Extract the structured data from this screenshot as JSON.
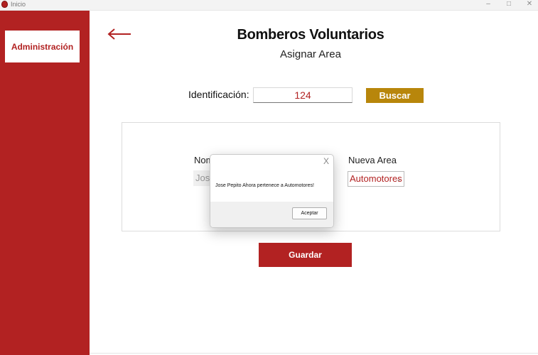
{
  "window": {
    "title": "Inicio",
    "minimize_icon": "minimize-icon",
    "maximize_icon": "maximize-icon",
    "close_icon": "close-icon"
  },
  "sidebar": {
    "admin_label": "Administración"
  },
  "header": {
    "title": "Bomberos Voluntarios",
    "subtitle": "Asignar Area",
    "back_icon": "arrow-left-icon"
  },
  "search": {
    "label": "Identificación:",
    "value": "124",
    "button_label": "Buscar"
  },
  "form": {
    "name_label": "Nom",
    "name_value": "Jose",
    "area_label": "Nueva Area",
    "area_value": "Automotores"
  },
  "actions": {
    "save_label": "Guardar"
  },
  "dialog": {
    "message": "Jose Pepito Ahora pertenece a Automotores!",
    "ok_label": "Aceptar",
    "close_glyph": "X"
  },
  "colors": {
    "brand_red": "#b22222",
    "search_gold": "#b8860b"
  }
}
